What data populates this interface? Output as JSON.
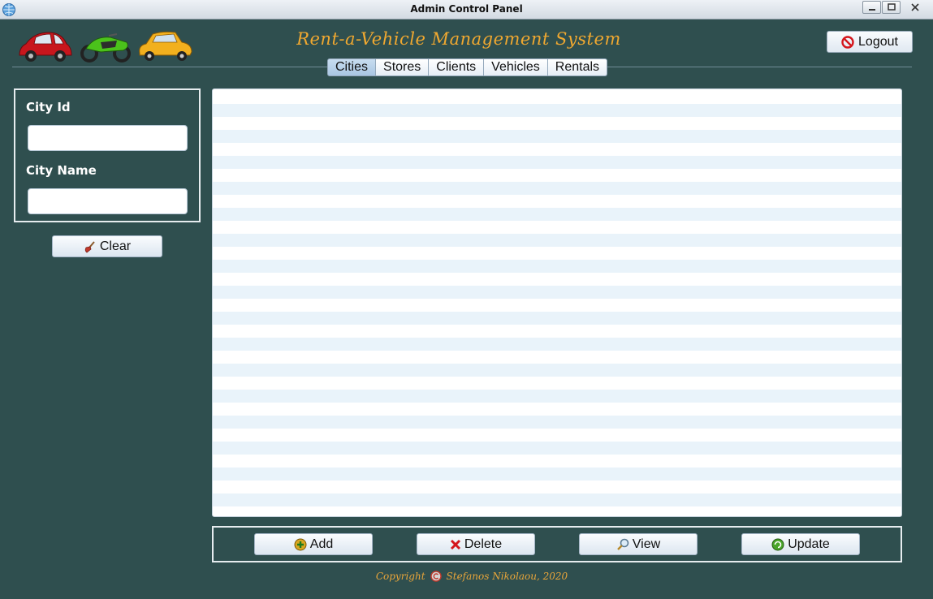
{
  "window": {
    "title": "Admin Control Panel",
    "icon": "globe-app-icon"
  },
  "header": {
    "app_title": "Rent-a-Vehicle Management System",
    "images": [
      "red-car-icon",
      "green-motorcycle-icon",
      "yellow-car-icon"
    ],
    "logout_label": "Logout",
    "logout_icon": "no-entry-icon"
  },
  "tabs": [
    {
      "label": "Cities",
      "active": true
    },
    {
      "label": "Stores",
      "active": false
    },
    {
      "label": "Clients",
      "active": false
    },
    {
      "label": "Vehicles",
      "active": false
    },
    {
      "label": "Rentals",
      "active": false
    }
  ],
  "form": {
    "city_id_label": "City Id",
    "city_id_value": "",
    "city_name_label": "City Name",
    "city_name_value": "",
    "clear_label": "Clear",
    "clear_icon": "broom-icon"
  },
  "table": {
    "rows": []
  },
  "actions": {
    "add_label": "Add",
    "delete_label": "Delete",
    "view_label": "View",
    "update_label": "Update"
  },
  "footer": {
    "copyright_label": "Copyright",
    "author": "Stefanos Nikolaou, 2020"
  },
  "colors": {
    "background": "#2f4f4f",
    "accent": "#f0a830",
    "table_stripe": "#e9f3fa"
  }
}
